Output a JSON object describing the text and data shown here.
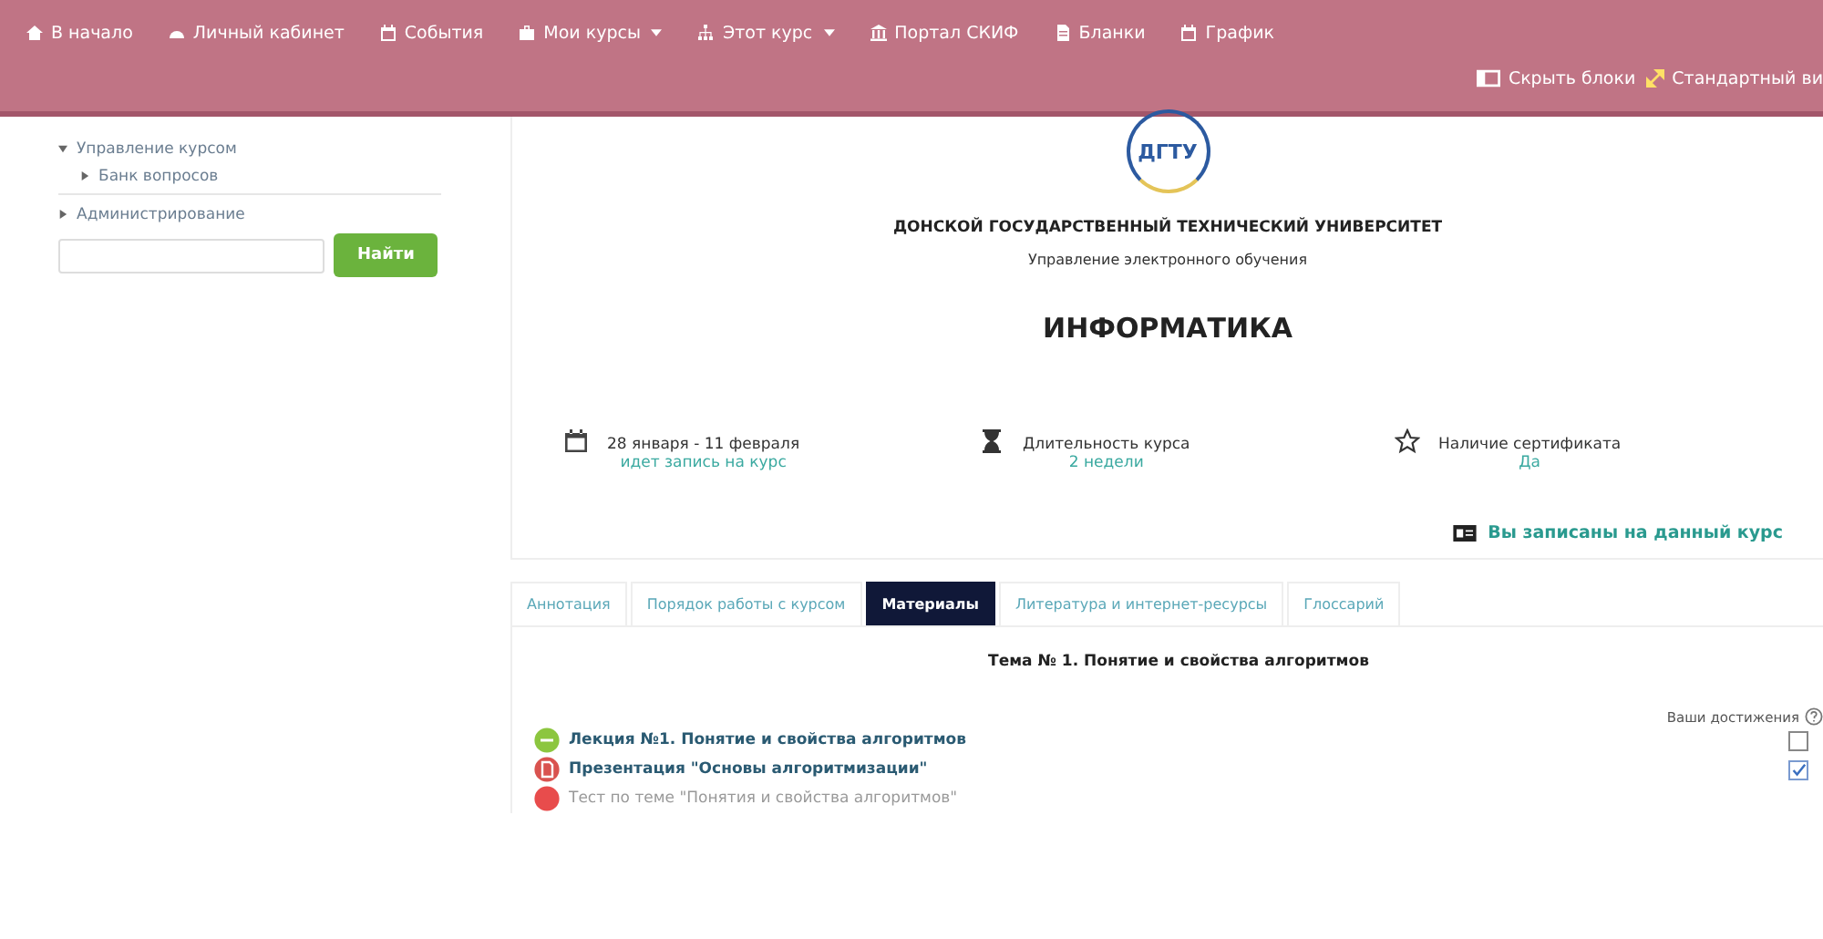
{
  "navbar": {
    "items": [
      {
        "kind": "home",
        "label": "В начало",
        "dropdown": false
      },
      {
        "kind": "dashboard",
        "label": "Личный кабинет",
        "dropdown": false
      },
      {
        "kind": "calendar",
        "label": "События",
        "dropdown": false
      },
      {
        "kind": "briefcase",
        "label": "Мои курсы",
        "dropdown": true
      },
      {
        "kind": "sitemap",
        "label": "Этот курс",
        "dropdown": true
      },
      {
        "kind": "bank",
        "label": "Портал СКИФ",
        "dropdown": false
      },
      {
        "kind": "file",
        "label": "Бланки",
        "dropdown": false
      },
      {
        "kind": "calendar",
        "label": "График",
        "dropdown": false
      }
    ],
    "actions": [
      {
        "kind": "blocks",
        "label": "Скрыть блоки"
      },
      {
        "kind": "expand",
        "label": "Стандартный ви"
      }
    ]
  },
  "sidebar": {
    "tree": [
      {
        "label": "Управление курсом",
        "expanded": true,
        "children": [
          {
            "label": "Банк вопросов",
            "expanded": false
          }
        ]
      },
      {
        "label": "Администрирование",
        "expanded": false
      }
    ],
    "search": {
      "button": "Найти"
    }
  },
  "header": {
    "logo_text": "ДГТУ",
    "university": "ДОНСКОЙ ГОСУДАРСТВЕННЫЙ ТЕХНИЧЕСКИЙ УНИВЕРСИТЕТ",
    "department": "Управление электронного обучения",
    "course": "ИНФОРМАТИКА"
  },
  "facts": [
    {
      "kind": "calendar",
      "title": "28 января  - 11 февраля",
      "value": "идет запись на курс"
    },
    {
      "kind": "hourglass",
      "title": "Длительность курса",
      "value": "2 недели"
    },
    {
      "kind": "star",
      "title": "Наличие сертификата",
      "value": "Да"
    }
  ],
  "enrolled": "Вы записаны на данный курс",
  "tabs": [
    {
      "label": "Аннотация",
      "selected": false
    },
    {
      "label": "Порядок работы с курсом",
      "selected": false
    },
    {
      "label": "Материалы",
      "selected": true
    },
    {
      "label": "Литература и интернет-ресурсы",
      "selected": false
    },
    {
      "label": "Глоссарий",
      "selected": false
    }
  ],
  "section": {
    "title": "Тема № 1. Понятие и свойства алгоритмов",
    "progress_label": "Ваши достижения",
    "activities": [
      {
        "kind": "lecture",
        "label": "Лекция №1. Понятие и свойства алгоритмов",
        "checked": false
      },
      {
        "kind": "presentation",
        "label": "Презентация \"Основы алгоритмизации\"",
        "checked": true
      },
      {
        "kind": "test",
        "label": "Тест по теме \"Понятия и свойства алгоритмов\""
      }
    ]
  }
}
